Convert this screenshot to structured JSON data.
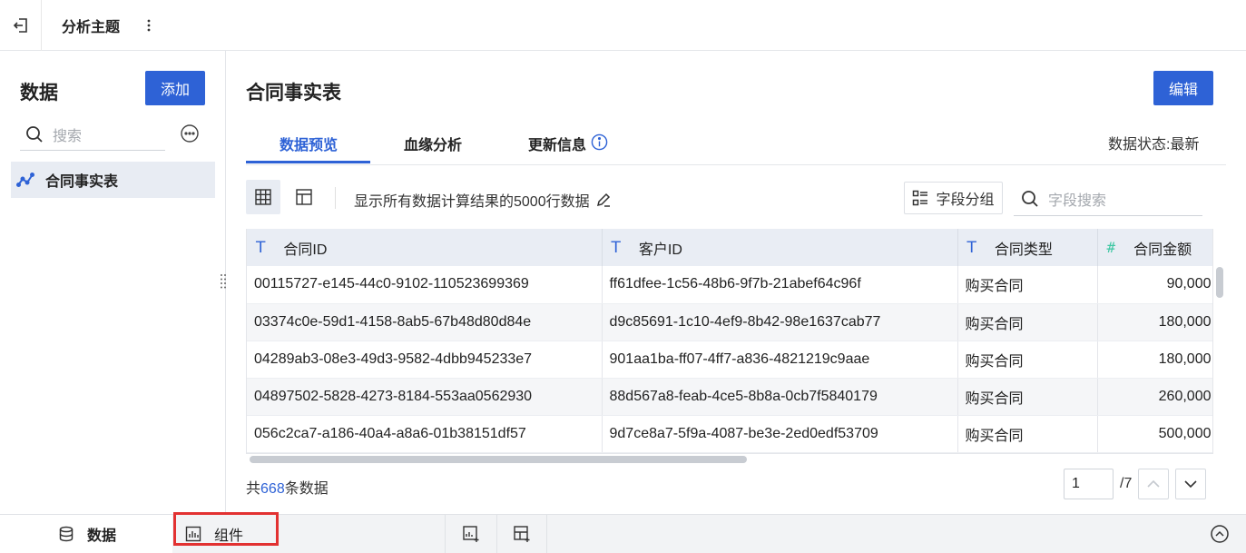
{
  "topbar": {
    "title": "分析主题",
    "exit_icon": "exit-icon",
    "more_icon": "more-vertical-icon"
  },
  "sidebar": {
    "title": "数据",
    "add_label": "添加",
    "search_placeholder": "搜索",
    "items": [
      {
        "label": "合同事实表",
        "icon": "dataset-icon"
      }
    ]
  },
  "main": {
    "title": "合同事实表",
    "edit_label": "编辑",
    "tabs": [
      {
        "label": "数据预览",
        "active": true
      },
      {
        "label": "血缘分析",
        "active": false
      },
      {
        "label": "更新信息",
        "active": false,
        "icon": "info-icon"
      }
    ],
    "status_label": "数据状态:",
    "status_value": "最新",
    "toolbar": {
      "result_text": "显示所有数据计算结果的5000行数据",
      "group_label": "字段分组",
      "field_search_placeholder": "字段搜索"
    },
    "table": {
      "columns": [
        {
          "label": "合同ID",
          "type": "text"
        },
        {
          "label": "客户ID",
          "type": "text"
        },
        {
          "label": "合同类型",
          "type": "text"
        },
        {
          "label": "合同金额",
          "type": "number"
        }
      ],
      "rows": [
        [
          "00115727-e145-44c0-9102-110523699369",
          "ff61dfee-1c56-48b6-9f7b-21abef64c96f",
          "购买合同",
          "90,000"
        ],
        [
          "03374c0e-59d1-4158-8ab5-67b48d80d84e",
          "d9c85691-1c10-4ef9-8b42-98e1637cab77",
          "购买合同",
          "180,000"
        ],
        [
          "04289ab3-08e3-49d3-9582-4dbb945233e7",
          "901aa1ba-ff07-4ff7-a836-4821219c9aae",
          "购买合同",
          "180,000"
        ],
        [
          "04897502-5828-4273-8184-553aa0562930",
          "88d567a8-feab-4ce5-8b8a-0cb7f5840179",
          "购买合同",
          "260,000"
        ],
        [
          "056c2ca7-a186-40a4-a8a6-01b38151df57",
          "9d7ce8a7-5f9a-4087-be3e-2ed0edf53709",
          "购买合同",
          "500,000"
        ]
      ]
    },
    "footer": {
      "count_prefix": "共",
      "count": "668",
      "count_suffix": "条数据",
      "page": "1",
      "total_pages": "/7"
    }
  },
  "bottombar": {
    "tabs": [
      {
        "label": "数据",
        "icon": "database-icon",
        "active": true
      },
      {
        "label": "组件",
        "icon": "bar-chart-icon",
        "active": false
      }
    ]
  },
  "colors": {
    "accent": "#2e62d6",
    "highlight": "#e23131"
  }
}
